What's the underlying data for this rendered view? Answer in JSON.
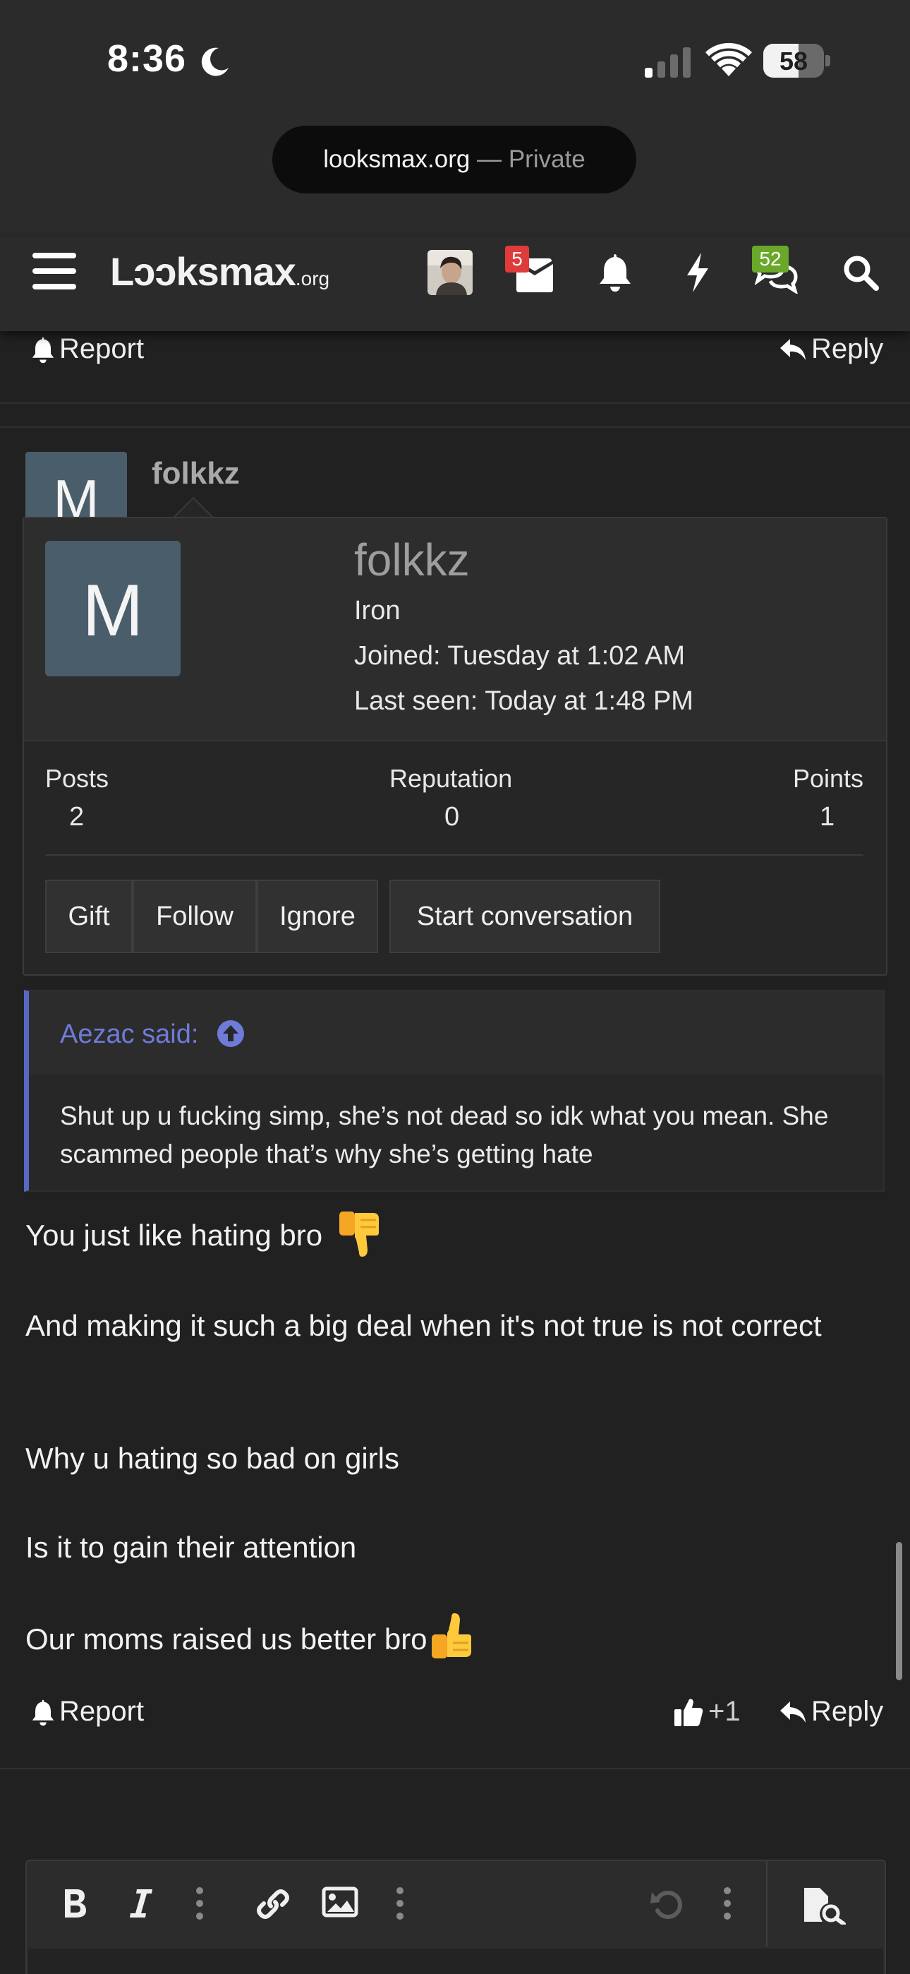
{
  "status_bar": {
    "time": "8:36",
    "battery_level": "58",
    "battery_fraction": 0.58
  },
  "url_bar": {
    "host": "looksmax.org",
    "separator": " — ",
    "mode": "Private"
  },
  "navbar": {
    "logo": "Lɔɔksmax",
    "logo_suffix": ".org",
    "inbox_count": "5",
    "discussions_count": "52",
    "icons": [
      "menu-icon",
      "user-avatar",
      "inbox-icon",
      "bell-icon",
      "bolt-icon",
      "discussions-icon",
      "search-icon"
    ]
  },
  "previous_post": {
    "report_label": "Report",
    "reply_label": "Reply"
  },
  "post": {
    "author": "folkkz",
    "avatar_letter": "M"
  },
  "member_tooltip": {
    "avatar_letter": "M",
    "name": "folkkz",
    "rank": "Iron",
    "joined": "Joined: Tuesday at 1:02 AM",
    "last_seen": "Last seen: Today at 1:48 PM",
    "stats": [
      {
        "label": "Posts",
        "value": "2"
      },
      {
        "label": "Reputation",
        "value": "0"
      },
      {
        "label": "Points",
        "value": "1"
      }
    ],
    "buttons": [
      "Gift",
      "Follow",
      "Ignore",
      "Start conversation"
    ]
  },
  "quote": {
    "author": "Aezac said:",
    "text": "Shut up u fucking simp, she’s not dead so idk what you mean. She scammed people that’s why she’s getting hate"
  },
  "post_body": {
    "lines": [
      "You just like hating bro",
      "And making it such a big deal when it's not true is not correct",
      "Why u hating so bad on girls",
      "Is it to gain their attention",
      "Our moms raised us better bro"
    ],
    "emojis": [
      "thumbs-down-emoji",
      "thumbs-up-emoji"
    ]
  },
  "post_footer": {
    "report_label": "Report",
    "like_count": "+1",
    "reply_label": "Reply"
  },
  "editor_toolbar": {
    "icons": [
      "bold-icon",
      "italic-icon",
      "more-vertical-icon",
      "link-icon",
      "image-icon",
      "more-vertical-icon",
      "undo-icon",
      "more-vertical-icon",
      "preview-icon"
    ]
  },
  "colors": {
    "background": "#212121",
    "quote_accent": "#5a67c4",
    "quote_author": "#6e7bd9",
    "inbox_badge": "#e03b3b",
    "discussions_badge": "#6aa829",
    "avatar_bg": "#4a5d6b"
  }
}
